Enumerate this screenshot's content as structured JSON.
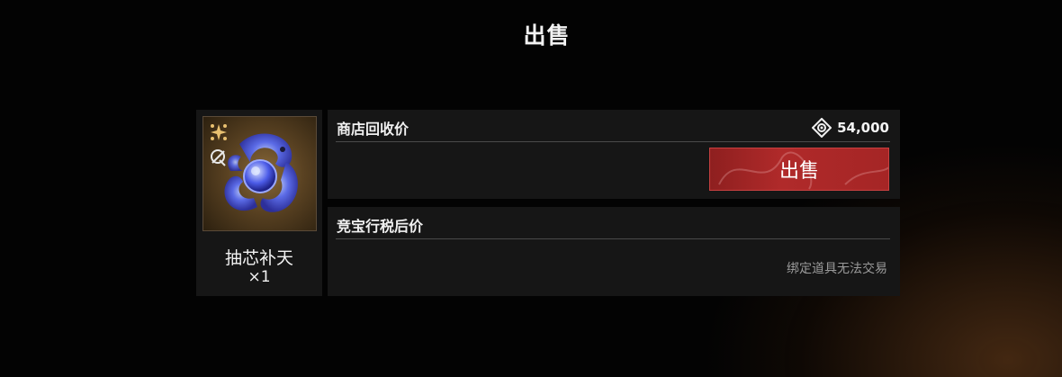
{
  "dialog": {
    "title": "出售"
  },
  "item": {
    "name": "抽芯补天",
    "quantity": "×1",
    "icon": "jade-dragon-pendant-icon",
    "badges": [
      "star-burst-icon",
      "bound-lock-icon"
    ]
  },
  "shop": {
    "label": "商店回收价",
    "currency_icon": "diamond-coin-icon",
    "price": "54,000",
    "sell_label": "出售"
  },
  "auction": {
    "label": "竞宝行税后价",
    "notice": "绑定道具无法交易"
  },
  "colors": {
    "accent": "#b02a2a",
    "panel": "#161616",
    "background": "#030303"
  }
}
